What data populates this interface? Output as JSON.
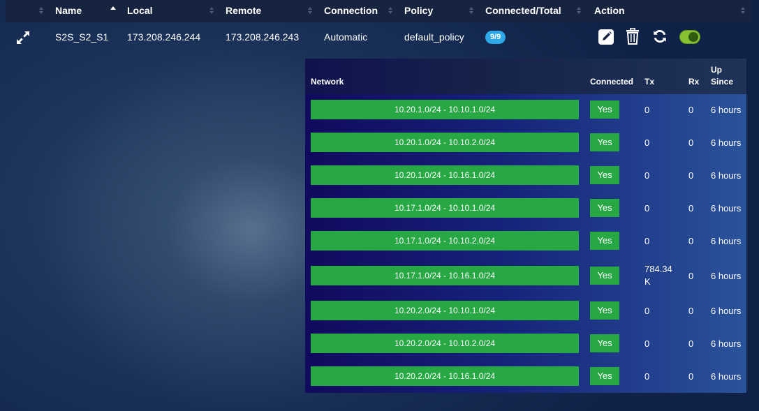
{
  "columns": {
    "name": "Name",
    "local": "Local",
    "remote": "Remote",
    "connection": "Connection",
    "policy": "Policy",
    "connected_total": "Connected/Total",
    "action": "Action"
  },
  "tunnel": {
    "name": "S2S_S2_S1",
    "local": "173.208.246.244",
    "remote": "173.208.246.243",
    "connection": "Automatic",
    "policy": "default_policy",
    "connected_total": "9/9",
    "enabled": true
  },
  "icons": {
    "expand": "expand-icon",
    "edit": "edit-icon",
    "delete": "trash-icon",
    "refresh": "refresh-icon",
    "toggle": "toggle-switch"
  },
  "colors": {
    "accent_green": "#28a745",
    "badge_blue": "#2ea8e8",
    "toggle_green": "#86c232"
  },
  "detail": {
    "headers": {
      "network": "Network",
      "connected": "Connected",
      "tx": "Tx",
      "rx": "Rx",
      "up_since_line1": "Up",
      "up_since_line2": "Since"
    },
    "rows": [
      {
        "network": "10.20.1.0/24 - 10.10.1.0/24",
        "connected": "Yes",
        "tx": "0",
        "rx": "0",
        "up_since": "6 hours"
      },
      {
        "network": "10.20.1.0/24 - 10.10.2.0/24",
        "connected": "Yes",
        "tx": "0",
        "rx": "0",
        "up_since": "6 hours"
      },
      {
        "network": "10.20.1.0/24 - 10.16.1.0/24",
        "connected": "Yes",
        "tx": "0",
        "rx": "0",
        "up_since": "6 hours"
      },
      {
        "network": "10.17.1.0/24 - 10.10.1.0/24",
        "connected": "Yes",
        "tx": "0",
        "rx": "0",
        "up_since": "6 hours"
      },
      {
        "network": "10.17.1.0/24 - 10.10.2.0/24",
        "connected": "Yes",
        "tx": "0",
        "rx": "0",
        "up_since": "6 hours"
      },
      {
        "network": "10.17.1.0/24 - 10.16.1.0/24",
        "connected": "Yes",
        "tx_line1": "784.34",
        "tx_line2": "K",
        "rx": "0",
        "up_since": "6 hours"
      },
      {
        "network": "10.20.2.0/24 - 10.10.1.0/24",
        "connected": "Yes",
        "tx": "0",
        "rx": "0",
        "up_since": "6 hours"
      },
      {
        "network": "10.20.2.0/24 - 10.10.2.0/24",
        "connected": "Yes",
        "tx": "0",
        "rx": "0",
        "up_since": "6 hours"
      },
      {
        "network": "10.20.2.0/24 - 10.16.1.0/24",
        "connected": "Yes",
        "tx": "0",
        "rx": "0",
        "up_since": "6 hours"
      }
    ]
  }
}
